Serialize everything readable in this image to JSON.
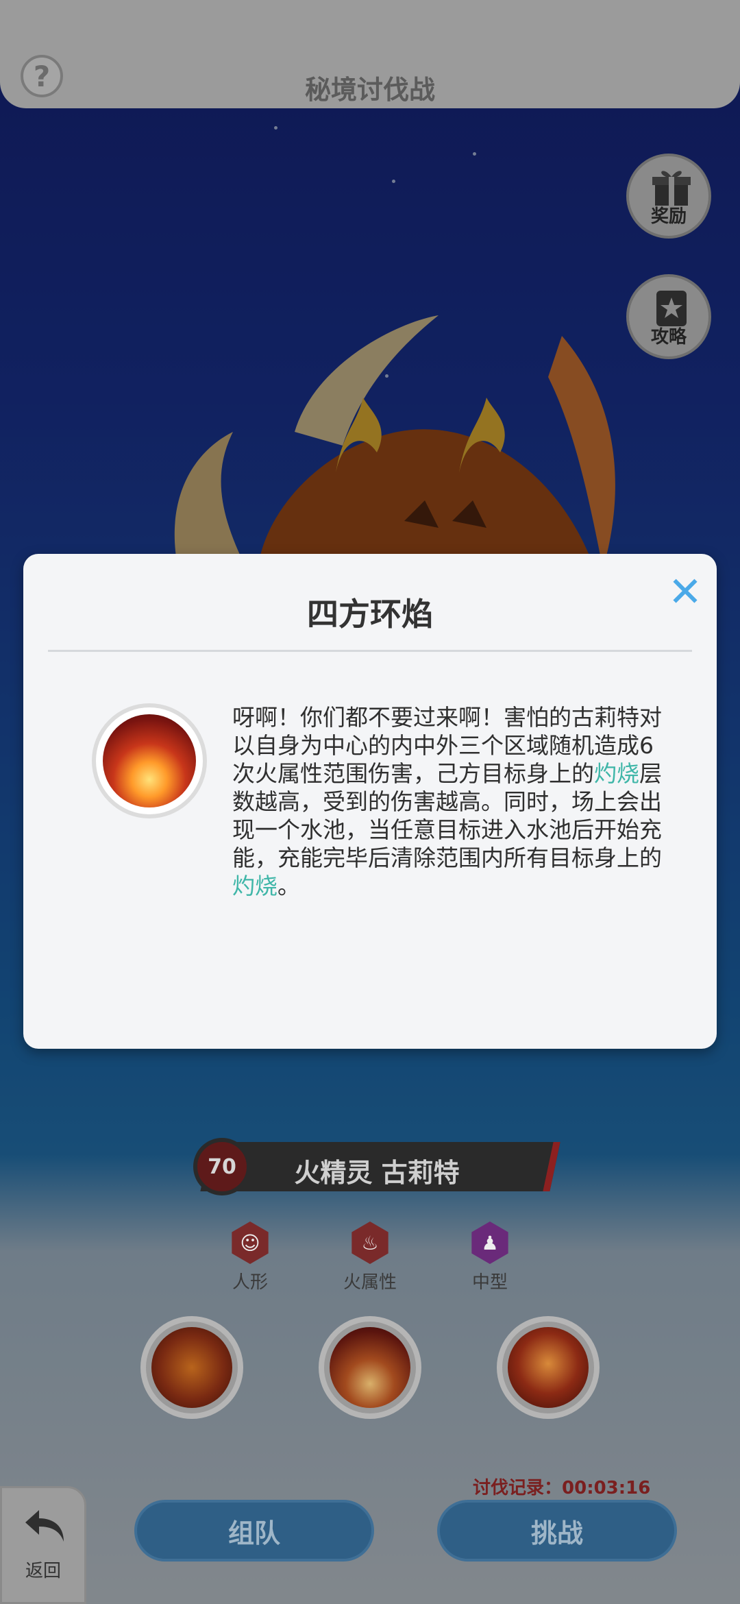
{
  "header": {
    "title": "秘境讨伐战",
    "help_icon": "?"
  },
  "side_buttons": [
    {
      "label": "奖励",
      "icon": "gift-icon"
    },
    {
      "label": "攻略",
      "icon": "guide-book-icon"
    }
  ],
  "boss": {
    "level": "70",
    "name": "火精灵 古莉特",
    "tags": [
      {
        "label": "人形",
        "icon": "humanoid-icon",
        "color": "#7a2a2a"
      },
      {
        "label": "火属性",
        "icon": "fire-icon",
        "color": "#7a2a2a"
      },
      {
        "label": "中型",
        "icon": "medium-size-icon",
        "color": "#6a2a7a"
      }
    ]
  },
  "skills": [
    {
      "name": "fire-swirl-skill"
    },
    {
      "name": "fire-pillar-skill"
    },
    {
      "name": "fire-orbs-skill"
    }
  ],
  "record": {
    "label": "讨伐记录：",
    "time": "00:03:16"
  },
  "actions": {
    "team_label": "组队",
    "challenge_label": "挑战",
    "back_label": "返回"
  },
  "modal": {
    "title": "四方环焰",
    "close_icon": "✕",
    "desc_before": "呀啊！你们都不要过来啊！害怕的古莉特对以自身为中心的内中外三个区域随机造成6次火属性范围伤害，己方目标身上的",
    "desc_hl1": "灼烧",
    "desc_mid": "层数越高，受到的伤害越高。同时，场上会出现一个水池，当任意目标进入水池后开始充能，充能完毕后清除范围内所有目标身上的",
    "desc_hl2": "灼烧",
    "desc_after": "。"
  },
  "colors": {
    "highlight": "#3fb6a8",
    "close": "#4aa9e8"
  }
}
